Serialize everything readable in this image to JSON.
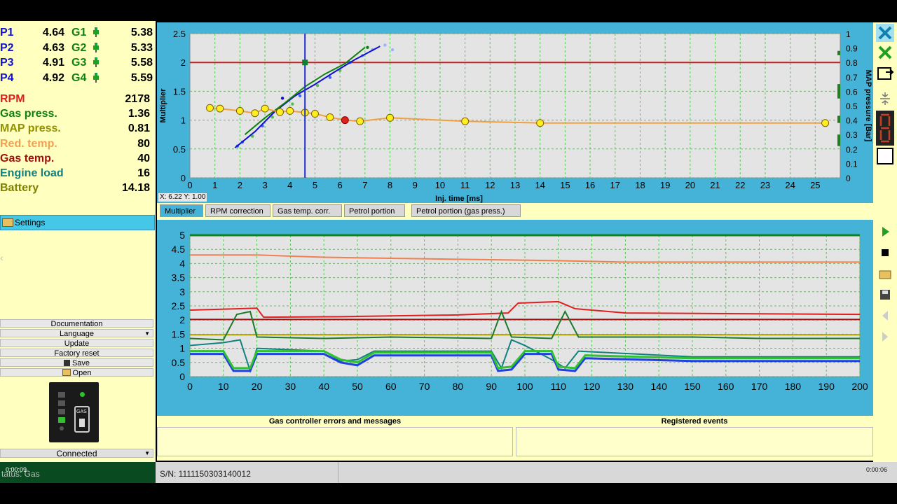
{
  "pressures": [
    {
      "p": "P1",
      "pv": "4.64",
      "g": "G1",
      "gv": "5.38"
    },
    {
      "p": "P2",
      "pv": "4.63",
      "g": "G2",
      "gv": "5.33"
    },
    {
      "p": "P3",
      "pv": "4.91",
      "g": "G3",
      "gv": "5.58"
    },
    {
      "p": "P4",
      "pv": "4.92",
      "g": "G4",
      "gv": "5.59"
    }
  ],
  "sensors": [
    {
      "label": "RPM",
      "value": "2178",
      "color": "#e02020"
    },
    {
      "label": "Gas press.",
      "value": "1.36",
      "color": "#108010"
    },
    {
      "label": "MAP press.",
      "value": "0.81",
      "color": "#909000"
    },
    {
      "label": "Red. temp.",
      "value": "80",
      "color": "#f0a050"
    },
    {
      "label": "Gas temp.",
      "value": "40",
      "color": "#a01010"
    },
    {
      "label": "Engine load",
      "value": "16",
      "color": "#108080"
    },
    {
      "label": "Battery",
      "value": "14.18",
      "color": "#808000"
    }
  ],
  "settings_label": "Settings",
  "menu": [
    "Documentation",
    "Language",
    "Update",
    "Factory reset",
    "Save",
    "Open"
  ],
  "connected_label": "Connected",
  "device_label": "GAS",
  "tabs": [
    "Multiplier",
    "RPM correction",
    "Gas temp. corr.",
    "Petrol portion",
    "Petrol portion (gas press.)"
  ],
  "top_chart": {
    "ylabel": "Multiplier",
    "xlabel": "Inj. time [ms]",
    "y2label": "MAP pressure [Bar]",
    "coord_readout": "X: 6.22  Y: 1.00",
    "y_ticks": [
      "0",
      "0.5",
      "1",
      "1.5",
      "2",
      "2.5"
    ],
    "y2_ticks": [
      "0",
      "0.1",
      "0.2",
      "0.3",
      "0.4",
      "0.5",
      "0.6",
      "0.7",
      "0.8",
      "0.9",
      "1"
    ],
    "x_ticks": [
      "1",
      "2",
      "3",
      "4",
      "5",
      "6",
      "7",
      "8",
      "9",
      "10",
      "11",
      "12",
      "13",
      "14",
      "15",
      "16",
      "17",
      "18",
      "19",
      "20",
      "21",
      "22",
      "23",
      "24",
      "25"
    ]
  },
  "bottom_chart": {
    "y_ticks": [
      "0",
      "0.5",
      "1",
      "1.5",
      "2",
      "2.5",
      "3",
      "3.5",
      "4",
      "4.5",
      "5"
    ],
    "x_ticks": [
      "0",
      "10",
      "20",
      "30",
      "40",
      "50",
      "60",
      "70",
      "80",
      "90",
      "100",
      "110",
      "120",
      "130",
      "140",
      "150",
      "160",
      "170",
      "180",
      "190",
      "200"
    ]
  },
  "errors_title": "Gas controller errors and messages",
  "events_title": "Registered events",
  "status_text": "tatus: Gas",
  "serial": "S/N: 1111150303140012",
  "time_left": "0:00:09",
  "time_right": "0:00:06",
  "chart_data": {
    "type": "line",
    "multiplier_curve": {
      "x": [
        0.8,
        1.2,
        2.0,
        2.6,
        3.0,
        3.6,
        4.0,
        4.6,
        5.0,
        5.6,
        6.2,
        6.8,
        8.0,
        11.0,
        14.0,
        25.4
      ],
      "y": [
        1.21,
        1.2,
        1.16,
        1.12,
        1.2,
        1.14,
        1.16,
        1.13,
        1.11,
        1.05,
        1.0,
        0.98,
        1.04,
        0.98,
        0.95,
        0.95
      ]
    },
    "highlighted_point": {
      "x": 6.2,
      "y": 1.0
    },
    "reference_line_y": 2.0,
    "cursor_x": 4.6,
    "petrol_fit": {
      "x": [
        1.8,
        2.6,
        3.4,
        4.2,
        5.0,
        5.8,
        6.6,
        7.6
      ],
      "y": [
        0.52,
        0.8,
        1.15,
        1.42,
        1.62,
        1.84,
        2.05,
        2.28
      ]
    },
    "gas_fit": {
      "x": [
        2.2,
        3.0,
        3.8,
        4.6,
        5.4,
        6.2,
        7.0
      ],
      "y": [
        0.75,
        1.04,
        1.3,
        1.58,
        1.8,
        1.98,
        2.26
      ]
    },
    "time_series": [
      {
        "name": "RPM",
        "color": "#e02020",
        "y": 2.2
      },
      {
        "name": "Gas press.",
        "color": "#108010",
        "y": 1.36
      },
      {
        "name": "MAP press.",
        "color": "#909000",
        "y": 0.81
      },
      {
        "name": "Red. temp.",
        "color": "#f0a050",
        "y": 4.2
      },
      {
        "name": "Gas temp.",
        "color": "#a01010",
        "y": 2.0
      },
      {
        "name": "Engine load",
        "color": "#108080",
        "y": 1.0
      },
      {
        "name": "Battery",
        "color": "#808000",
        "y": 1.48
      }
    ]
  }
}
